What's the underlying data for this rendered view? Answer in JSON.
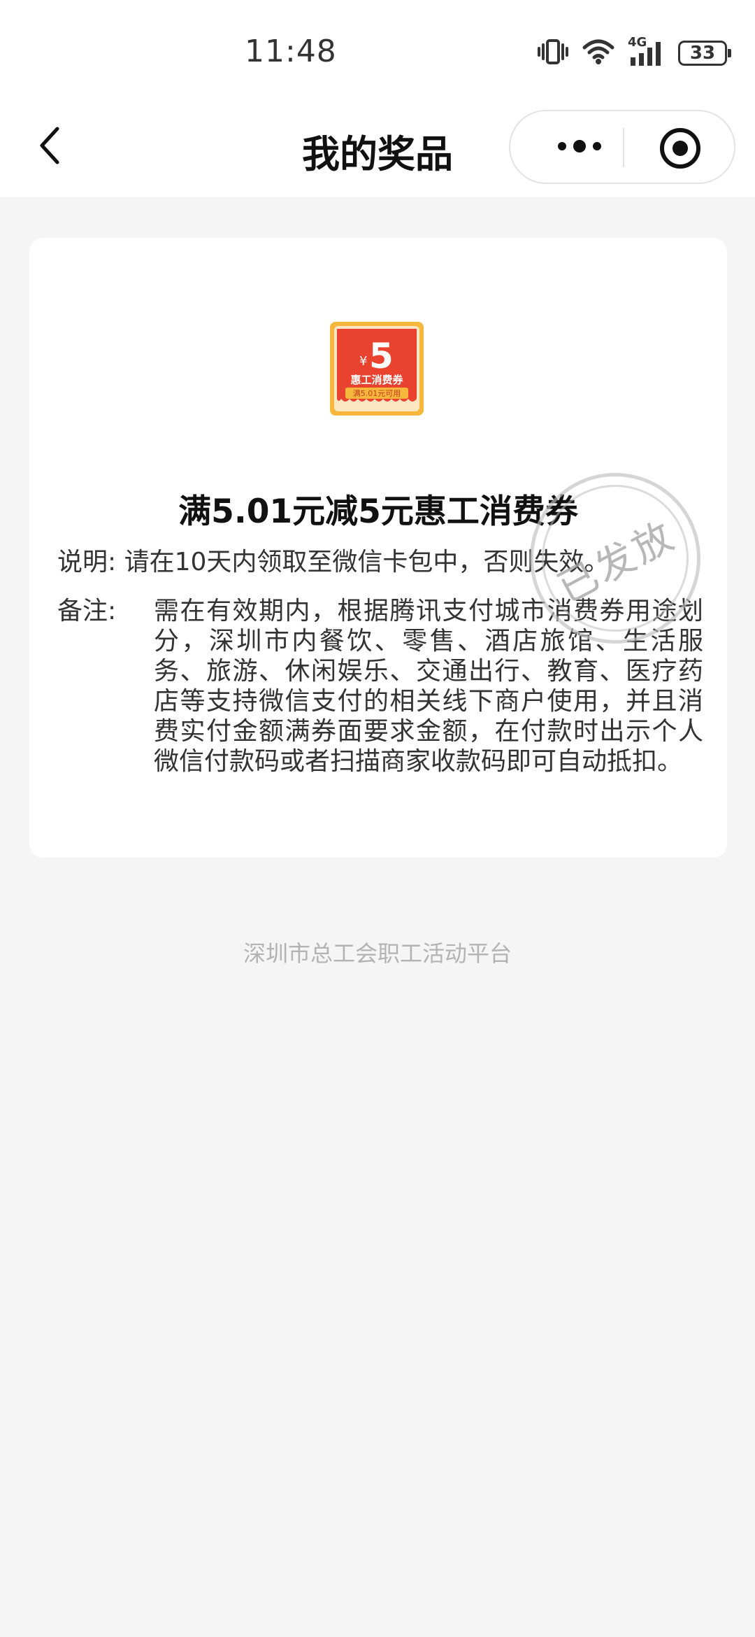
{
  "status_bar": {
    "time": "11:48",
    "network": "4G",
    "battery": "33"
  },
  "nav": {
    "title": "我的奖品"
  },
  "prize": {
    "coupon_image": {
      "amount": "5",
      "currency": "¥",
      "name": "惠工消费券",
      "condition": "满5.01元可用"
    },
    "title": "满5.01元减5元惠工消费券",
    "desc_label": "说明:",
    "desc_text": "请在10天内领取至微信卡包中，否则失效。",
    "note_label": "备注:",
    "note_text": "需在有效期内，根据腾讯支付城市消费券用途划分，深圳市内餐饮、零售、酒店旅馆、生活服务、旅游、休闲娱乐、交通出行、教育、医疗药店等支持微信支付的相关线下商户使用，并且消费实付金额满券面要求金额，在付款时出示个人微信付款码或者扫描商家收款码即可自动抵扣。",
    "stamp": "已发放"
  },
  "footer": {
    "text": "深圳市总工会职工活动平台"
  },
  "colors": {
    "page_bg": "#f5f5f5",
    "coupon_red": "#e9432f",
    "coupon_gold": "#f6b73c"
  }
}
